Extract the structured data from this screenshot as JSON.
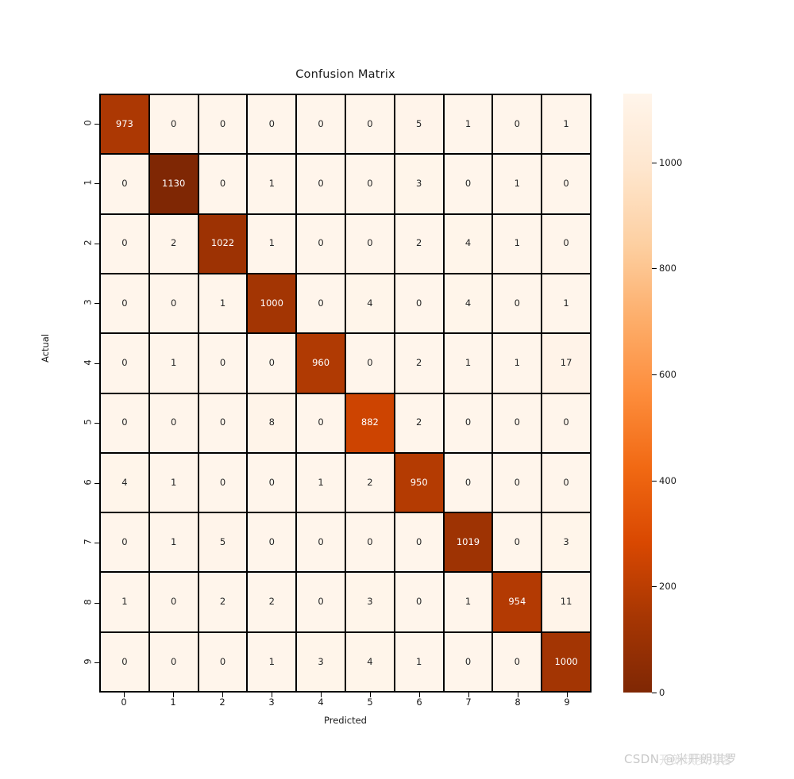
{
  "chart_data": {
    "type": "heatmap",
    "title": "Confusion Matrix",
    "xlabel": "Predicted",
    "ylabel": "Actual",
    "grid": false,
    "legend_position": "right-colorbar",
    "colormap": "Oranges",
    "x_categories": [
      "0",
      "1",
      "2",
      "3",
      "4",
      "5",
      "6",
      "7",
      "8",
      "9"
    ],
    "y_categories": [
      "0",
      "1",
      "2",
      "3",
      "4",
      "5",
      "6",
      "7",
      "8",
      "9"
    ],
    "colorbar": {
      "ticks": [
        1000,
        800,
        600,
        400,
        200,
        0
      ],
      "tick_labels": [
        "1000",
        "800",
        "600",
        "400",
        "200",
        "0"
      ],
      "vmin": 0,
      "vmax": 1130,
      "low_color": "#fff5eb",
      "high_color": "#7f2704"
    },
    "values": [
      [
        973,
        0,
        0,
        0,
        0,
        0,
        5,
        1,
        0,
        1
      ],
      [
        0,
        1130,
        0,
        1,
        0,
        0,
        3,
        0,
        1,
        0
      ],
      [
        0,
        2,
        1022,
        1,
        0,
        0,
        2,
        4,
        1,
        0
      ],
      [
        0,
        0,
        1,
        1000,
        0,
        4,
        0,
        4,
        0,
        1
      ],
      [
        0,
        1,
        0,
        0,
        960,
        0,
        2,
        1,
        1,
        17
      ],
      [
        0,
        0,
        0,
        8,
        0,
        882,
        2,
        0,
        0,
        0
      ],
      [
        4,
        1,
        0,
        0,
        1,
        2,
        950,
        0,
        0,
        0
      ],
      [
        0,
        1,
        5,
        0,
        0,
        0,
        0,
        1019,
        0,
        3
      ],
      [
        1,
        0,
        2,
        2,
        0,
        3,
        0,
        1,
        954,
        11
      ],
      [
        0,
        0,
        0,
        1,
        3,
        4,
        1,
        0,
        0,
        1000
      ]
    ]
  },
  "watermark": {
    "text": "CSDN @米开朗琪罗",
    "overlay_text": "开朗琪罗儿客"
  }
}
